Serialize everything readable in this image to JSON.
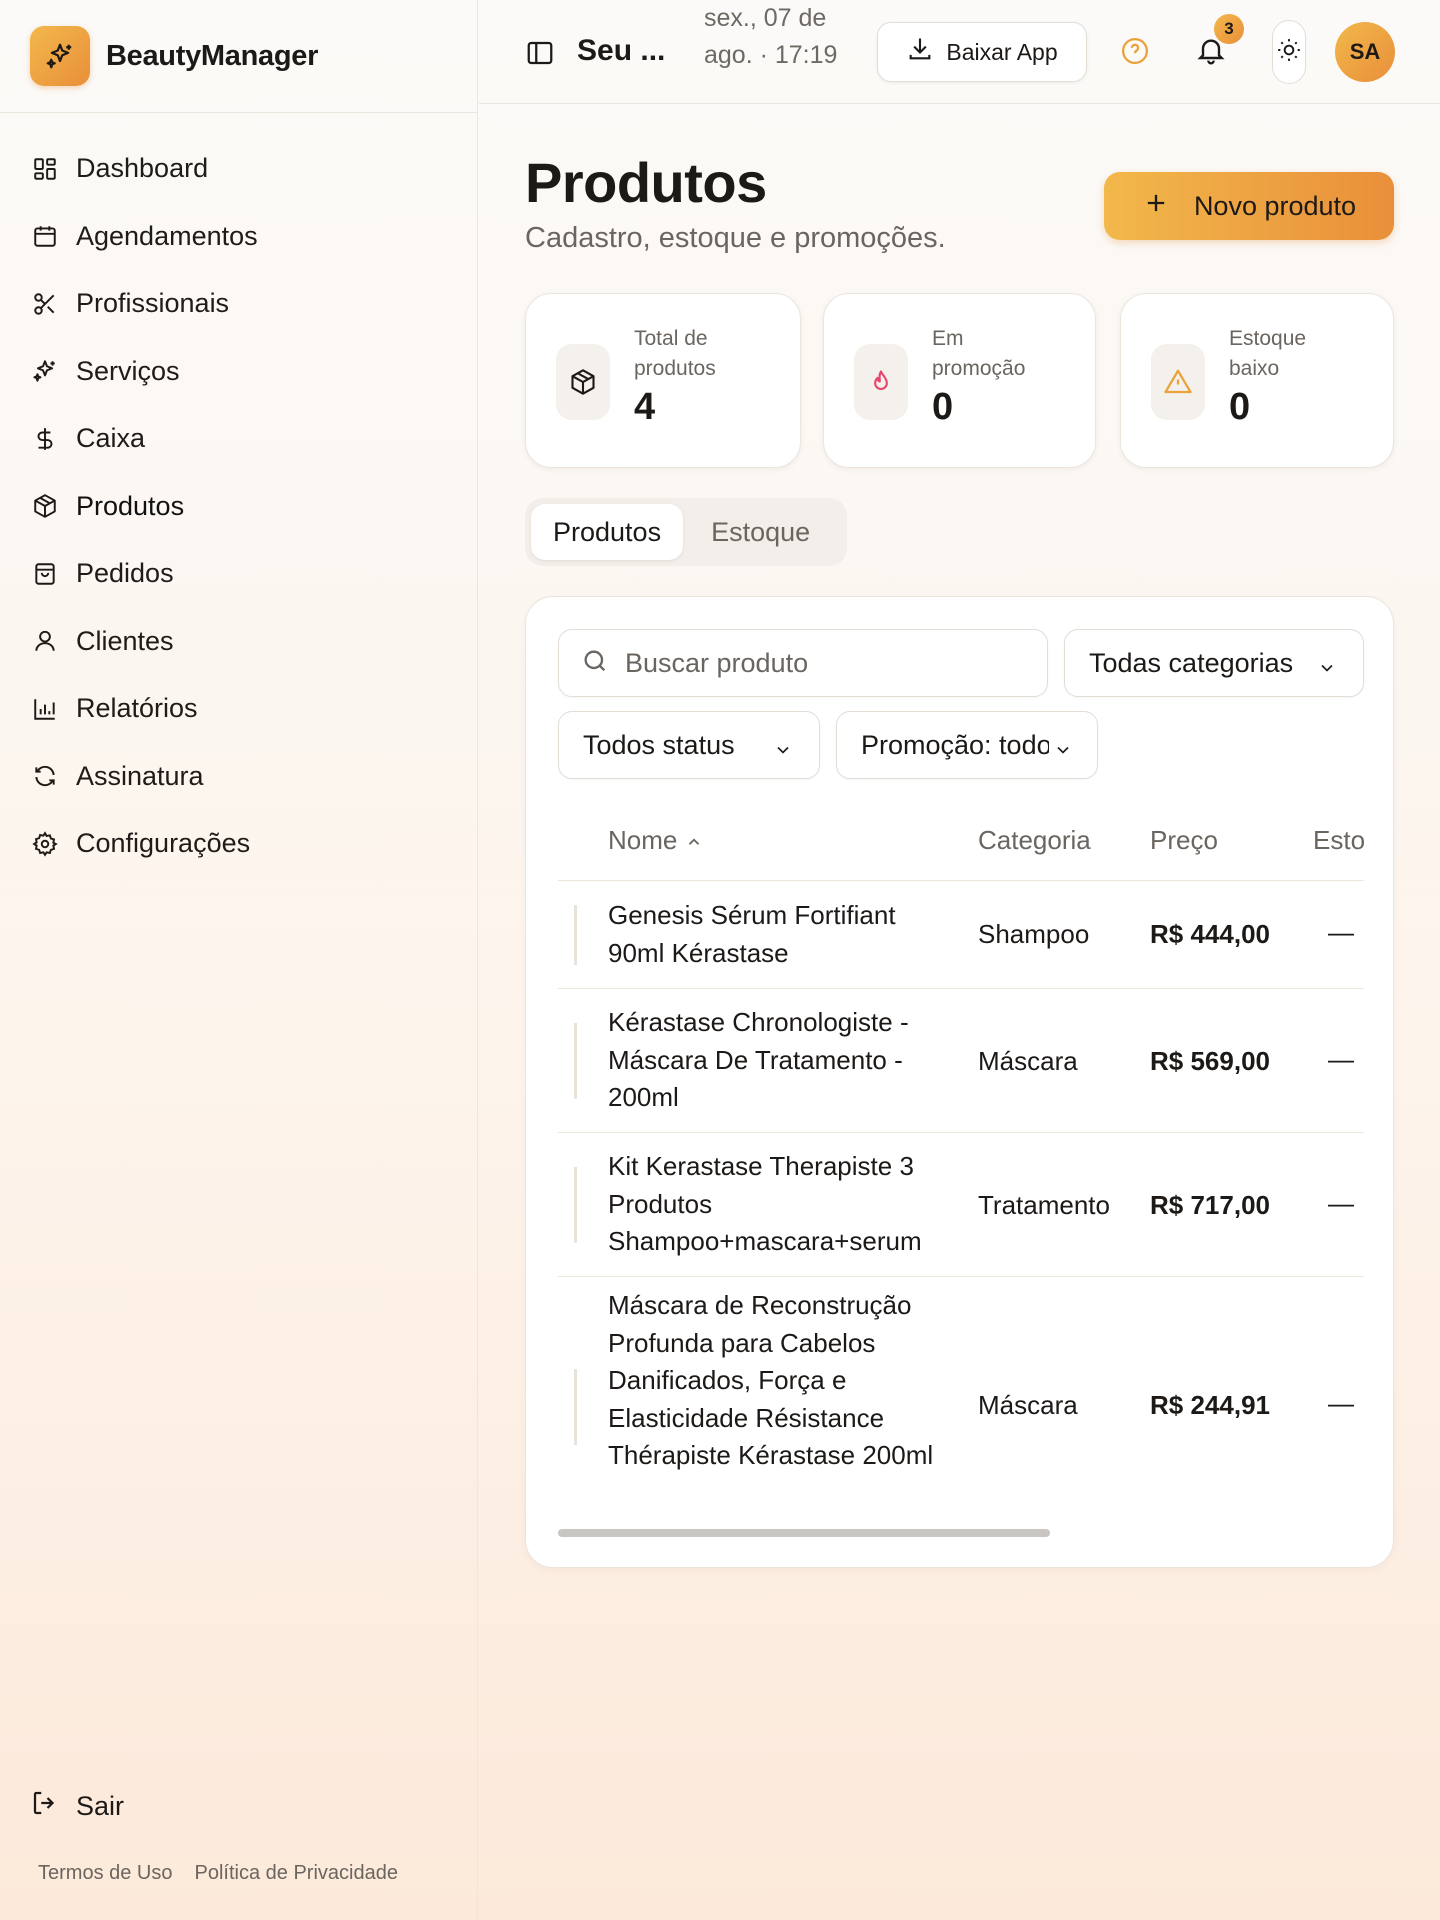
{
  "app": {
    "name": "BeautyManager"
  },
  "sidebar": {
    "items": [
      {
        "label": "Dashboard",
        "icon": "dashboard-icon"
      },
      {
        "label": "Agendamentos",
        "icon": "calendar-icon"
      },
      {
        "label": "Profissionais",
        "icon": "scissors-icon"
      },
      {
        "label": "Serviços",
        "icon": "sparkles-icon"
      },
      {
        "label": "Caixa",
        "icon": "dollar-icon"
      },
      {
        "label": "Produtos",
        "icon": "package-icon"
      },
      {
        "label": "Pedidos",
        "icon": "shopping-bag-icon"
      },
      {
        "label": "Clientes",
        "icon": "user-icon"
      },
      {
        "label": "Relatórios",
        "icon": "chart-icon"
      },
      {
        "label": "Assinatura",
        "icon": "refresh-icon"
      },
      {
        "label": "Configurações",
        "icon": "gear-icon"
      }
    ],
    "active": "Produtos",
    "logout": "Sair",
    "footer": {
      "terms": "Termos de Uso",
      "privacy": "Política de Privacidade"
    }
  },
  "topbar": {
    "title": "Seu ...",
    "date": "sex., 07 de ago. · 17:19",
    "download_label": "Baixar App",
    "notifications_count": "3",
    "avatar_initials": "SA"
  },
  "page": {
    "title": "Produtos",
    "subtitle": "Cadastro, estoque e promoções.",
    "new_button": "Novo produto"
  },
  "stats": [
    {
      "label": "Total de produtos",
      "value": "4",
      "icon": "package-icon"
    },
    {
      "label": "Em promoção",
      "value": "0",
      "icon": "flame-icon"
    },
    {
      "label": "Estoque baixo",
      "value": "0",
      "icon": "warning-icon"
    }
  ],
  "tabs": [
    {
      "label": "Produtos",
      "active": true
    },
    {
      "label": "Estoque",
      "active": false
    }
  ],
  "filters": {
    "search_placeholder": "Buscar produto",
    "category": "Todas categorias",
    "status": "Todos status",
    "promotion": "Promoção: todos"
  },
  "table": {
    "columns": {
      "name": "Nome",
      "category": "Categoria",
      "price": "Preço",
      "stock": "Esto"
    },
    "rows": [
      {
        "name": "Genesis Sérum Fortifiant 90ml Kérastase",
        "category": "Shampoo",
        "price": "R$ 444,00",
        "stock": "—"
      },
      {
        "name": "Kérastase Chronologiste - Máscara De Tratamento - 200ml",
        "category": "Máscara",
        "price": "R$ 569,00",
        "stock": "—"
      },
      {
        "name": "Kit Kerastase Therapiste 3 Produtos Shampoo+mascara+serum",
        "category": "Tratamento",
        "price": "R$ 717,00",
        "stock": "—"
      },
      {
        "name": "Máscara de Reconstrução Profunda para Cabelos Danificados, Força e Elasticidade Résistance Thérapiste Kérastase 200ml",
        "category": "Máscara",
        "price": "R$ 244,91",
        "stock": "—"
      }
    ]
  },
  "colors": {
    "accent_start": "#f2b84b",
    "accent_end": "#e98f3a",
    "flame": "#e8456b",
    "warning": "#eaa23a"
  }
}
